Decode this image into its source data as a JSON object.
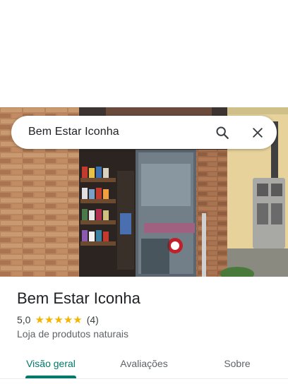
{
  "search": {
    "query": "Bem Estar Iconha",
    "search_icon": "search-icon",
    "close_icon": "close-icon"
  },
  "place": {
    "name": "Bem Estar Iconha",
    "rating": "5,0",
    "rating_stars": 5,
    "review_count": "(4)",
    "category": "Loja de produtos naturais"
  },
  "tabs": [
    {
      "label": "Visão geral",
      "active": true
    },
    {
      "label": "Avaliações",
      "active": false
    },
    {
      "label": "Sobre",
      "active": false
    }
  ],
  "colors": {
    "accent": "#00796b",
    "star": "#f4b400",
    "text_primary": "#202124",
    "text_secondary": "#5f6368"
  }
}
